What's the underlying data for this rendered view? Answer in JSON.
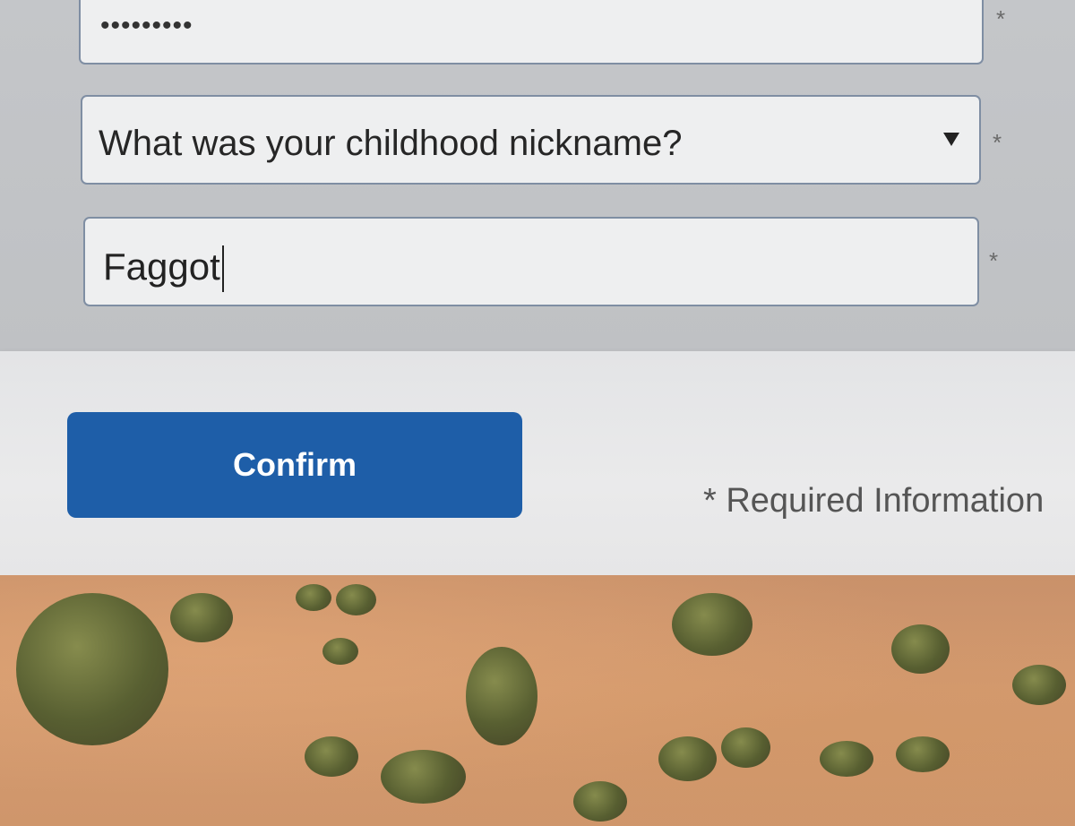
{
  "password": {
    "masked_value": "•••••••••",
    "required_marker": "*"
  },
  "security_question": {
    "selected": "What was your childhood nickname?",
    "required_marker": "*"
  },
  "security_answer": {
    "value": "Faggot",
    "required_marker": "*"
  },
  "footer": {
    "confirm_label": "Confirm",
    "required_note": "* Required Information"
  },
  "colors": {
    "primary_button": "#1e5ea8",
    "field_border": "#7f8ea3",
    "panel_bg": "#c4c6c9"
  }
}
